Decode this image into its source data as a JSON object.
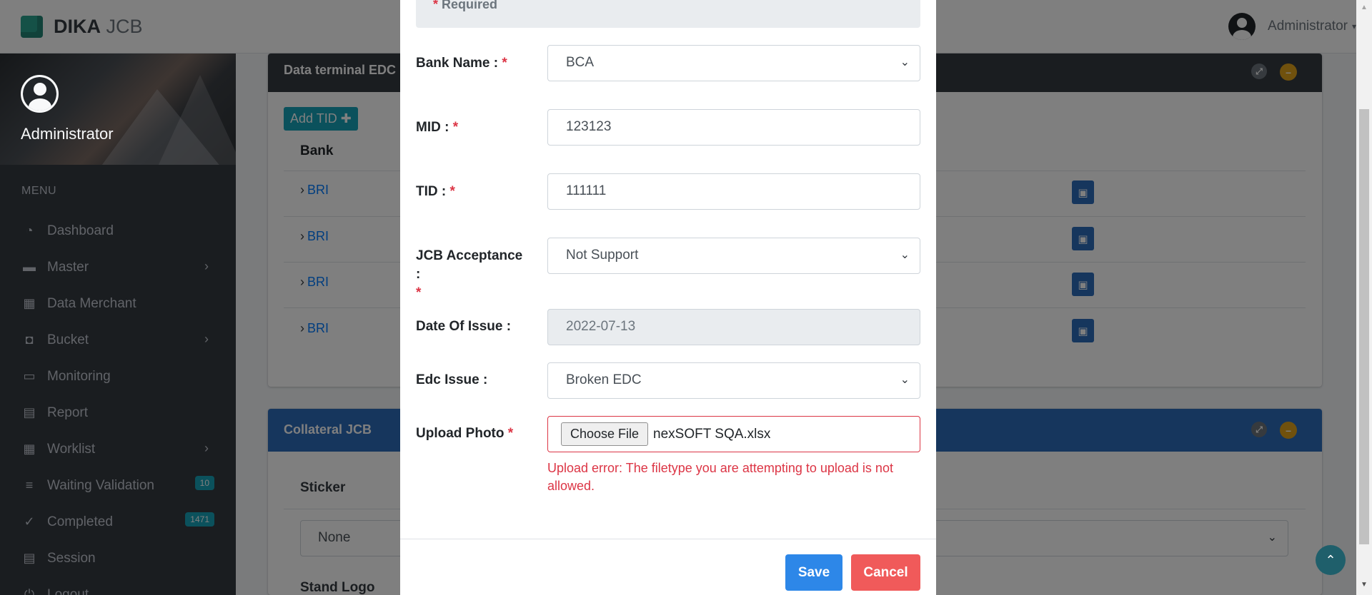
{
  "header": {
    "brand_bold": "DIKA",
    "brand_light": " JCB",
    "user_name": "Administrator",
    "caret_icon": "▾"
  },
  "sidebar": {
    "user_name": "Administrator",
    "menu_header": "MENU",
    "items": [
      {
        "label": "Dashboard",
        "icon": "tachometer-icon",
        "glyph": "◔"
      },
      {
        "label": "Master",
        "icon": "folder-icon",
        "glyph": "▬",
        "arrow": "›"
      },
      {
        "label": "Data Merchant",
        "icon": "table-icon",
        "glyph": "▦"
      },
      {
        "label": "Bucket",
        "icon": "bucket-icon",
        "glyph": "◘",
        "arrow": "›"
      },
      {
        "label": "Monitoring",
        "icon": "desktop-icon",
        "glyph": "▭"
      },
      {
        "label": "Report",
        "icon": "calendar-icon",
        "glyph": "▤"
      },
      {
        "label": "Worklist",
        "icon": "table-icon",
        "glyph": "▦",
        "arrow": "›"
      },
      {
        "label": "Waiting Validation",
        "icon": "list-icon",
        "glyph": "≡",
        "badge": "10"
      },
      {
        "label": "Completed",
        "icon": "check-icon",
        "glyph": "✓",
        "badge": "1471"
      },
      {
        "label": "Session",
        "icon": "calendar-icon",
        "glyph": "▤"
      },
      {
        "label": "Logout",
        "icon": "power-icon",
        "glyph": "⏻"
      }
    ]
  },
  "terminal_card": {
    "title": "Data terminal EDC",
    "add_button": "Add TID ✚",
    "column_bank": "Bank",
    "rows": [
      {
        "bank": "BRI"
      },
      {
        "bank": "BRI"
      },
      {
        "bank": "BRI"
      },
      {
        "bank": "BRI"
      }
    ]
  },
  "collateral_card": {
    "title": "Collateral JCB",
    "sticker_label": "Sticker",
    "sticker_value": "None",
    "stand_logo_label": "Stand Logo"
  },
  "modal": {
    "required_note": "Required",
    "required_star": "*",
    "fields": {
      "bank_name": {
        "label": "Bank Name :",
        "value": "BCA"
      },
      "mid": {
        "label": "MID :",
        "value": "123123"
      },
      "tid": {
        "label": "TID :",
        "value": "111111"
      },
      "jcb_acceptance": {
        "label": "JCB Acceptance :",
        "value": "Not Support"
      },
      "date_of_issue": {
        "label": "Date Of Issue :",
        "value": "2022-07-13"
      },
      "edc_issue": {
        "label": "Edc Issue :",
        "value": "Broken EDC"
      },
      "upload_photo": {
        "label": "Upload Photo",
        "button": "Choose File",
        "file_name": "nexSOFT SQA.xlsx",
        "error": "Upload error: The filetype you are attempting to upload is not allowed."
      }
    },
    "save_label": "Save",
    "cancel_label": "Cancel"
  },
  "colors": {
    "sidebar_bg": "#343a40",
    "accent_blue": "#2d87e8",
    "danger": "#dc3545",
    "info": "#17a2b8",
    "brand_green": "#2aa38f"
  }
}
